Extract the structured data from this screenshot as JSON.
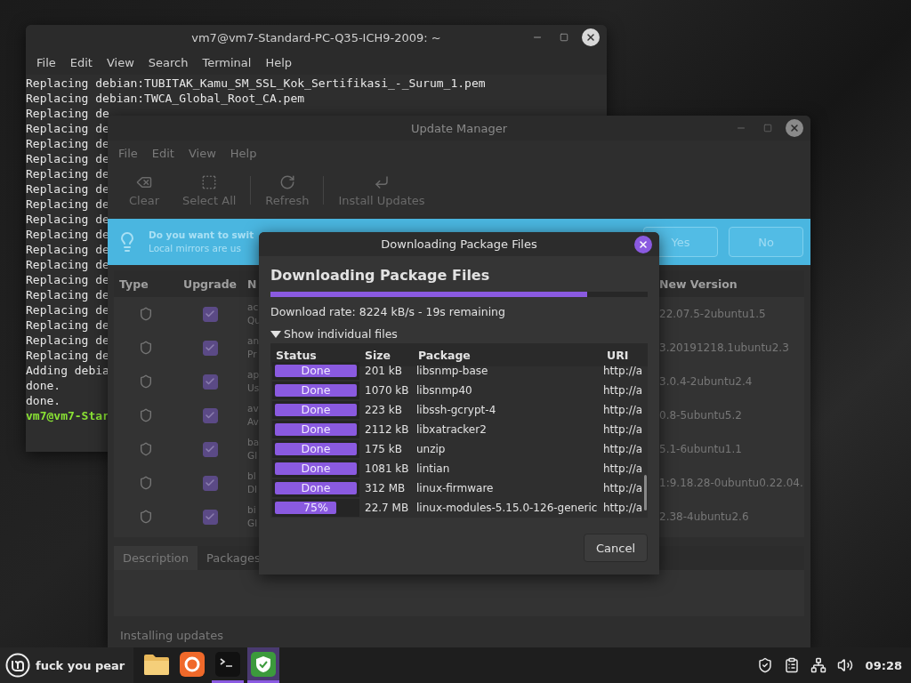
{
  "terminal": {
    "title": "vm7@vm7-Standard-PC-Q35-ICH9-2009: ~",
    "menu": [
      "File",
      "Edit",
      "View",
      "Search",
      "Terminal",
      "Help"
    ],
    "lines": [
      {
        "kind": "output",
        "text": "Replacing debian:TUBITAK_Kamu_SM_SSL_Kok_Sertifikasi_-_Surum_1.pem"
      },
      {
        "kind": "output",
        "text": "Replacing debian:TWCA_Global_Root_CA.pem"
      },
      {
        "kind": "output",
        "text": "Replacing de"
      },
      {
        "kind": "output",
        "text": "Replacing de"
      },
      {
        "kind": "output",
        "text": "Replacing de"
      },
      {
        "kind": "output",
        "text": "Replacing de"
      },
      {
        "kind": "output",
        "text": "Replacing de"
      },
      {
        "kind": "output",
        "text": "Replacing de"
      },
      {
        "kind": "output",
        "text": "Replacing de"
      },
      {
        "kind": "output",
        "text": "Replacing de"
      },
      {
        "kind": "output",
        "text": "Replacing de"
      },
      {
        "kind": "output",
        "text": "Replacing de"
      },
      {
        "kind": "output",
        "text": "Replacing de"
      },
      {
        "kind": "output",
        "text": "Replacing de"
      },
      {
        "kind": "output",
        "text": "Replacing de"
      },
      {
        "kind": "output",
        "text": "Replacing de"
      },
      {
        "kind": "output",
        "text": "Replacing de"
      },
      {
        "kind": "output",
        "text": "Replacing de"
      },
      {
        "kind": "output",
        "text": "Replacing de"
      },
      {
        "kind": "output",
        "text": "Adding debia"
      },
      {
        "kind": "output",
        "text": "done."
      },
      {
        "kind": "output",
        "text": "done."
      },
      {
        "kind": "prompt",
        "text": "vm7@vm7-Star"
      }
    ]
  },
  "update_manager": {
    "title": "Update Manager",
    "menu": [
      "File",
      "Edit",
      "View",
      "Help"
    ],
    "toolbar": [
      {
        "kind": "clear",
        "label": "Clear",
        "disabled": true
      },
      {
        "kind": "select",
        "label": "Select All",
        "disabled": true
      },
      {
        "kind": "refresh",
        "label": "Refresh",
        "disabled": true
      },
      {
        "kind": "install",
        "label": "Install Updates",
        "disabled": true
      }
    ],
    "banner": {
      "title": "Do you want to swit",
      "text": "Local mirrors are us",
      "buttons": [
        "Yes",
        "No"
      ]
    },
    "table": {
      "columns": [
        "Type",
        "Upgrade",
        "N",
        "New Version"
      ],
      "rows": [
        {
          "checked": true,
          "name": "ac",
          "description": "Qu",
          "new_version": "22.07.5-2ubuntu1.5"
        },
        {
          "checked": true,
          "name": "an",
          "description": "Pr",
          "new_version": "3.20191218.1ubuntu2.3"
        },
        {
          "checked": true,
          "name": "ap",
          "description": "Us",
          "new_version": "3.0.4-2ubuntu2.4"
        },
        {
          "checked": true,
          "name": "av",
          "description": "Av",
          "new_version": "0.8-5ubuntu5.2"
        },
        {
          "checked": true,
          "name": "ba",
          "description": "Gl",
          "new_version": "5.1-6ubuntu1.1"
        },
        {
          "checked": true,
          "name": "bl",
          "description": "Dl",
          "new_version": "1:9.18.28-0ubuntu0.22.04."
        },
        {
          "checked": true,
          "name": "bi",
          "description": "Gl",
          "new_version": "2.38-4ubuntu2.6"
        }
      ]
    },
    "tabs": [
      {
        "label": "Description",
        "selected": true
      },
      {
        "label": "Packages",
        "selected": false
      }
    ],
    "status": "Installing updates"
  },
  "dialog": {
    "title": "Downloading Package Files",
    "heading": "Downloading Package Files",
    "level": 0.84,
    "rate": "Download rate: 8224 kB/s - 19s remaining",
    "expander": {
      "label": "Show individual files",
      "expanded": true
    },
    "columns": [
      "Status",
      "Size",
      "Package",
      "URI"
    ],
    "files": [
      {
        "status": "Done",
        "level": 1,
        "size": "201 kB",
        "package": "libsnmp-base",
        "uri": "http://a"
      },
      {
        "status": "Done",
        "level": 1,
        "size": "1070 kB",
        "package": "libsnmp40",
        "uri": "http://a"
      },
      {
        "status": "Done",
        "level": 1,
        "size": "223 kB",
        "package": "libssh-gcrypt-4",
        "uri": "http://a"
      },
      {
        "status": "Done",
        "level": 1,
        "size": "2112 kB",
        "package": "libxatracker2",
        "uri": "http://a"
      },
      {
        "status": "Done",
        "level": 1,
        "size": "175 kB",
        "package": "unzip",
        "uri": "http://a"
      },
      {
        "status": "Done",
        "level": 1,
        "size": "1081 kB",
        "package": "lintian",
        "uri": "http://a"
      },
      {
        "status": "Done",
        "level": 1,
        "size": "312 MB",
        "package": "linux-firmware",
        "uri": "http://a"
      },
      {
        "status": "75%",
        "level": 0.75,
        "size": "22.7 MB",
        "package": "linux-modules-5.15.0-126-generic",
        "uri": "http://a"
      }
    ],
    "cancel": "Cancel"
  },
  "taskbar": {
    "menu_label": "fuck you pear",
    "launchers": [
      {
        "kind": "folder",
        "running": false,
        "selected": false
      },
      {
        "kind": "browser",
        "running": false,
        "selected": false
      },
      {
        "kind": "terminal",
        "running": true,
        "selected": false
      },
      {
        "kind": "shield",
        "running": true,
        "selected": true
      }
    ],
    "tray": [
      {
        "kind": "shield"
      },
      {
        "kind": "clipboard"
      },
      {
        "kind": "network"
      },
      {
        "kind": "volume"
      }
    ],
    "clock": "09:28"
  }
}
